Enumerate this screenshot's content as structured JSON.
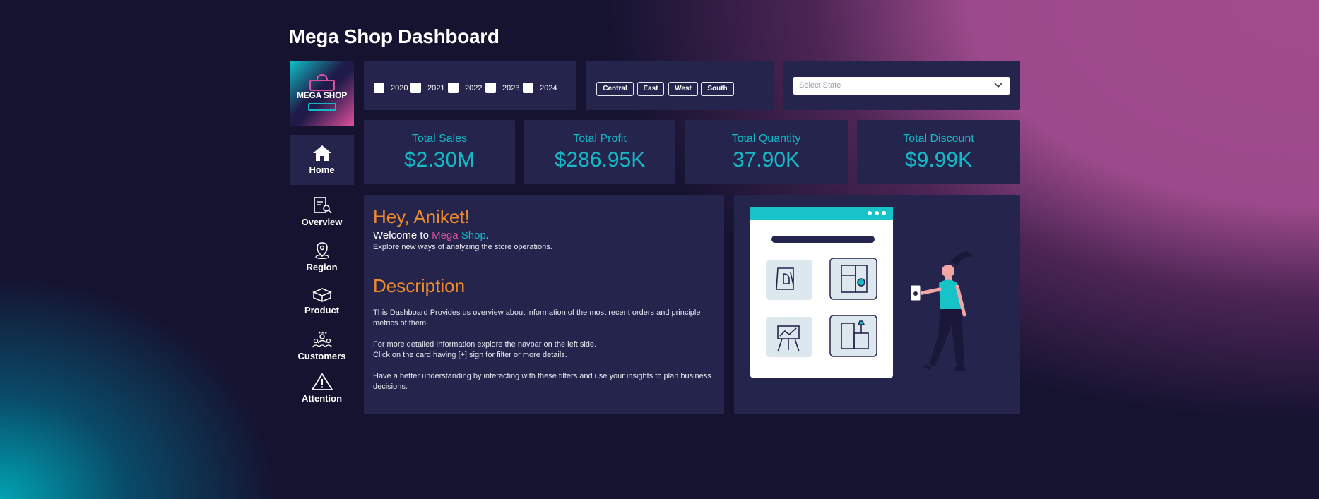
{
  "page": {
    "title": "Mega Shop Dashboard"
  },
  "logo": {
    "text": "MEGA SHOP"
  },
  "nav": {
    "items": [
      {
        "label": "Home",
        "icon": "home-icon",
        "active": true
      },
      {
        "label": "Overview",
        "icon": "document-search-icon"
      },
      {
        "label": "Region",
        "icon": "map-pin-icon"
      },
      {
        "label": "Product",
        "icon": "box-icon"
      },
      {
        "label": "Customers",
        "icon": "users-icon"
      },
      {
        "label": "Attention",
        "icon": "warning-icon"
      }
    ]
  },
  "filters": {
    "years": [
      "2020",
      "2021",
      "2022",
      "2023",
      "2024"
    ],
    "regions": [
      "Central",
      "East",
      "West",
      "South"
    ],
    "state_select": {
      "placeholder": "Select State"
    }
  },
  "kpis": [
    {
      "label": "Total Sales",
      "value": "$2.30M"
    },
    {
      "label": "Total Profit",
      "value": "$286.95K"
    },
    {
      "label": "Total Quantity",
      "value": "37.90K"
    },
    {
      "label": "Total Discount",
      "value": "$9.99K"
    }
  ],
  "welcome": {
    "greeting": "Hey, Aniket!",
    "prefix": "Welcome to ",
    "brand_mega": "Mega",
    "brand_shop": "Shop",
    "suffix": ".",
    "subtitle": "Explore new ways of analyzing the store operations.",
    "description_heading": "Description",
    "paragraphs": [
      "This Dashboard Provides us overview about information of the most recent orders and principle metrics of them.",
      "For more detailed Information explore the navbar on the left side.",
      "Click on the card having [+] sign for filter or more details.",
      "Have a better understanding by interacting with these filters and use your insights to plan business decisions."
    ]
  },
  "colors": {
    "accent_teal": "#17b8c6",
    "accent_orange": "#f08a2c",
    "accent_pink": "#e04f9b",
    "panel": "#25244d",
    "background": "#151330"
  }
}
